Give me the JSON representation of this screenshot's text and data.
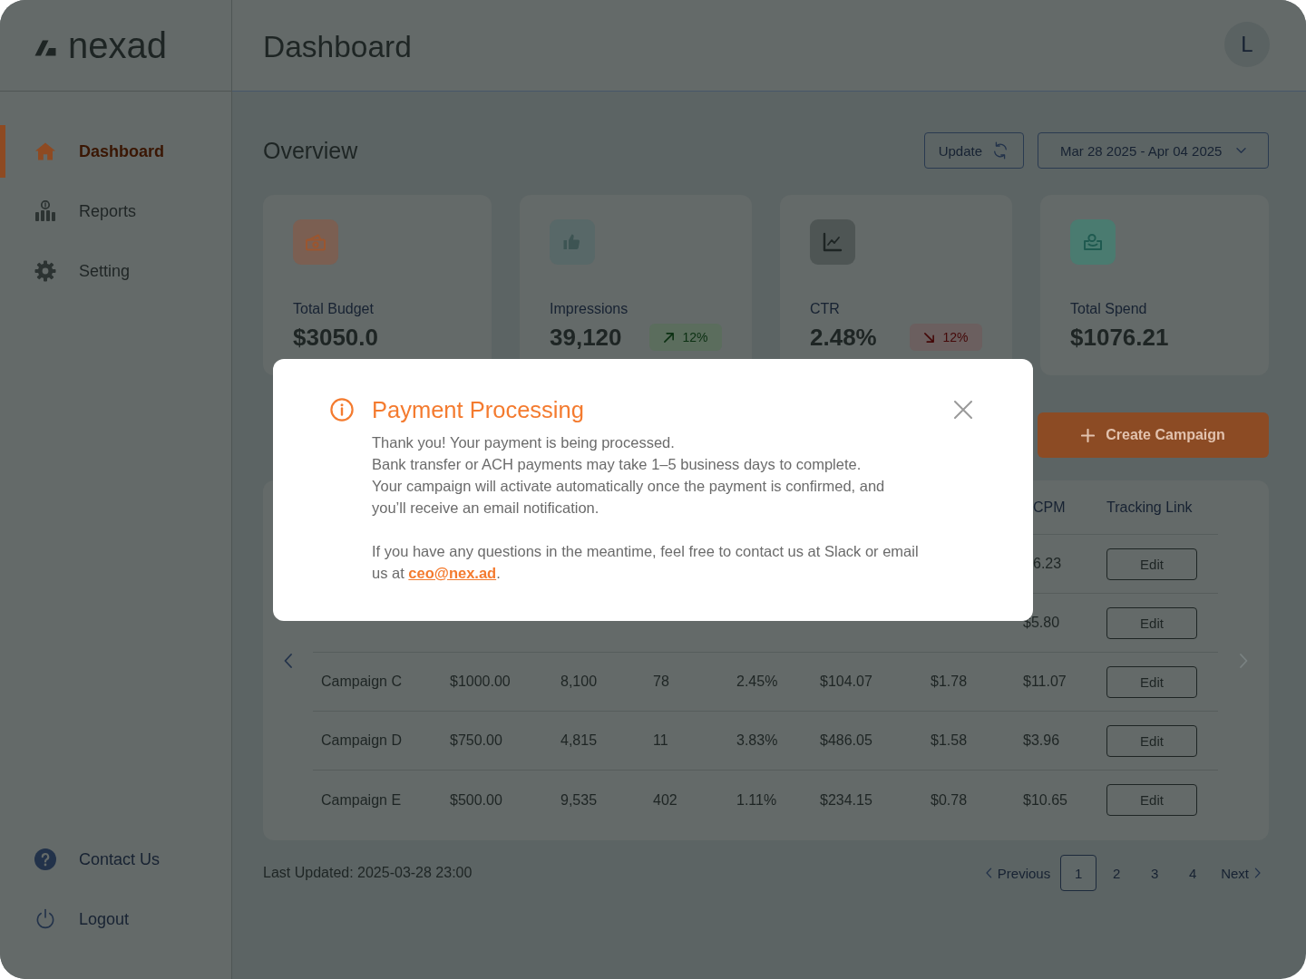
{
  "app": {
    "logo": "nexad",
    "title": "Dashboard",
    "avatar": "L"
  },
  "sidebar": {
    "items": [
      {
        "label": "Dashboard",
        "selected": true
      },
      {
        "label": "Reports",
        "selected": false
      },
      {
        "label": "Setting",
        "selected": false
      }
    ],
    "bottom_items": [
      {
        "label": "Contact Us"
      },
      {
        "label": "Logout"
      }
    ]
  },
  "overview": {
    "title": "Overview",
    "update_button": "Update",
    "date_range": "Mar 28 2025 - Apr 04 2025",
    "cards": [
      {
        "label": "Total Budget",
        "value": "$3050.0"
      },
      {
        "label": "Impressions",
        "value": "39,120",
        "badge": {
          "kind": "up",
          "text": "12%"
        }
      },
      {
        "label": "CTR",
        "value": "2.48%",
        "badge": {
          "kind": "down",
          "text": "12%"
        }
      },
      {
        "label": "Total Spend",
        "value": "$1076.21"
      }
    ]
  },
  "campaigns": {
    "create_button": "Create Campaign"
  },
  "table": {
    "header": {
      "kind": "cut",
      "columns": [
        "CPM",
        "Tracking Link"
      ]
    },
    "rows": [
      {
        "kind": "cut",
        "cells": [
          "6.23"
        ],
        "action": "Edit"
      },
      {
        "kind": "whole",
        "cells": [
          "$5.80"
        ],
        "action": "Edit"
      },
      {
        "kind": "whole",
        "cells": [
          "Campaign C",
          "$1000.00",
          "8,100",
          "78",
          "2.45%",
          "$104.07",
          "$1.78",
          "$11.07"
        ],
        "action": "Edit"
      },
      {
        "kind": "whole",
        "cells": [
          "Campaign D",
          "$750.00",
          "4,815",
          "11",
          "3.83%",
          "$486.05",
          "$1.58",
          "$3.96"
        ],
        "action": "Edit"
      },
      {
        "kind": "whole",
        "cells": [
          "Campaign E",
          "$500.00",
          "9,535",
          "402",
          "1.11%",
          "$234.15",
          "$0.78",
          "$10.65"
        ],
        "action": "Edit"
      }
    ],
    "nav": [
      {
        "disabled": false
      },
      {
        "disabled": true
      }
    ]
  },
  "footer": {
    "last_updated": "Last Updated: 2025-03-28 23:00"
  },
  "pagination": {
    "previous": "Previous",
    "pages": [
      {
        "label": "1",
        "selected": true
      },
      {
        "label": "2",
        "selected": false
      },
      {
        "label": "3",
        "selected": false
      },
      {
        "label": "4",
        "selected": false
      }
    ],
    "next": "Next"
  },
  "dialog": {
    "title": "Payment Processing",
    "message": "Thank you! Your payment is being processed.\nBank transfer or ACH payments may take 1–5 business days to complete.\nYour campaign will activate automatically once the payment is confirmed, and you’ll receive an email notification.",
    "contact": {
      "text": "If you have any questions in the meantime, feel free to contact us at Slack or email us at ",
      "link": "ceo@nex.ad",
      "after": "."
    }
  }
}
